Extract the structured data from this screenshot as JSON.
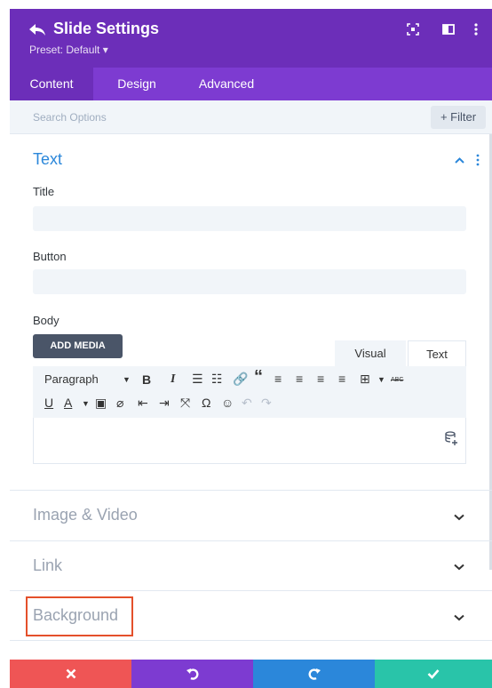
{
  "header": {
    "title": "Slide Settings",
    "preset": "Preset: Default ▾",
    "background": "#6c2eb9",
    "icons": [
      "back-arrow-icon",
      "expand-icon",
      "split-view-icon",
      "more-vertical-icon"
    ]
  },
  "tabs": [
    {
      "label": "Content",
      "active": true
    },
    {
      "label": "Design",
      "active": false
    },
    {
      "label": "Advanced",
      "active": false
    }
  ],
  "search": {
    "placeholder": "Search Options",
    "filter_label": "+ Filter"
  },
  "text_section": {
    "title": "Text",
    "title_field_label": "Title",
    "title_value": "",
    "button_field_label": "Button",
    "button_value": "",
    "body_label": "Body",
    "add_media_label": "ADD MEDIA",
    "editor_tabs": [
      "Visual",
      "Text"
    ],
    "paragraph_select": "Paragraph",
    "accent_color": "#2b87da"
  },
  "toggles": [
    {
      "label": "Image & Video"
    },
    {
      "label": "Link"
    },
    {
      "label": "Background"
    }
  ],
  "bottom_bar": {
    "cancel_color": "#ef5555",
    "undo_color": "#7d3bd1",
    "redo_color": "#2b87da",
    "save_color": "#29c4a9"
  }
}
